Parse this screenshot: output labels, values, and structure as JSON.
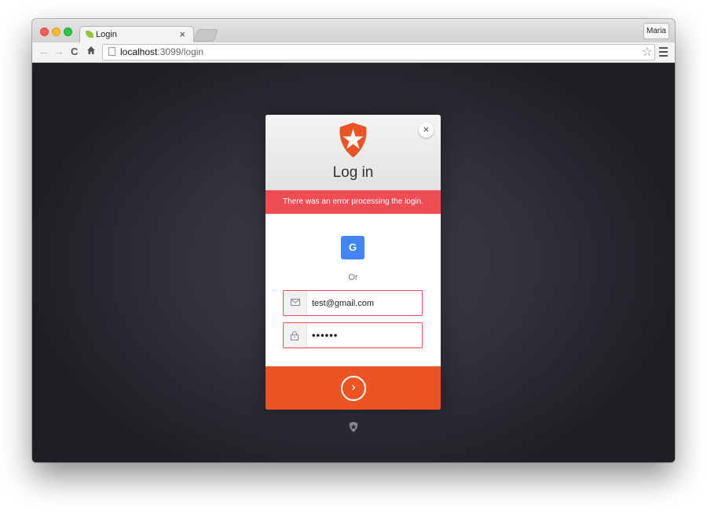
{
  "browser": {
    "tab": {
      "title": "Login",
      "close_glyph": "×"
    },
    "profile_name": "Maria",
    "url": {
      "host": "localhost",
      "rest": ":3099/login"
    }
  },
  "login": {
    "title": "Log in",
    "close_glyph": "×",
    "error_message": "There was an error processing the login.",
    "social_button_label": "G",
    "divider_text": "Or",
    "email_value": "test@gmail.com",
    "password_value": "••••••",
    "submit_glyph": "›"
  },
  "colors": {
    "accent": "#eb5424",
    "error": "#f04c54",
    "google": "#4285f4",
    "backdrop": "#30303a"
  },
  "icons": [
    "back-arrow-icon",
    "forward-arrow-icon",
    "reload-icon",
    "home-icon",
    "page-icon",
    "bookmark-star-icon",
    "menu-icon",
    "auth0-logo",
    "close-icon",
    "google-icon",
    "envelope-icon",
    "lock-icon",
    "arrow-right-icon",
    "auth0-badge-icon"
  ]
}
